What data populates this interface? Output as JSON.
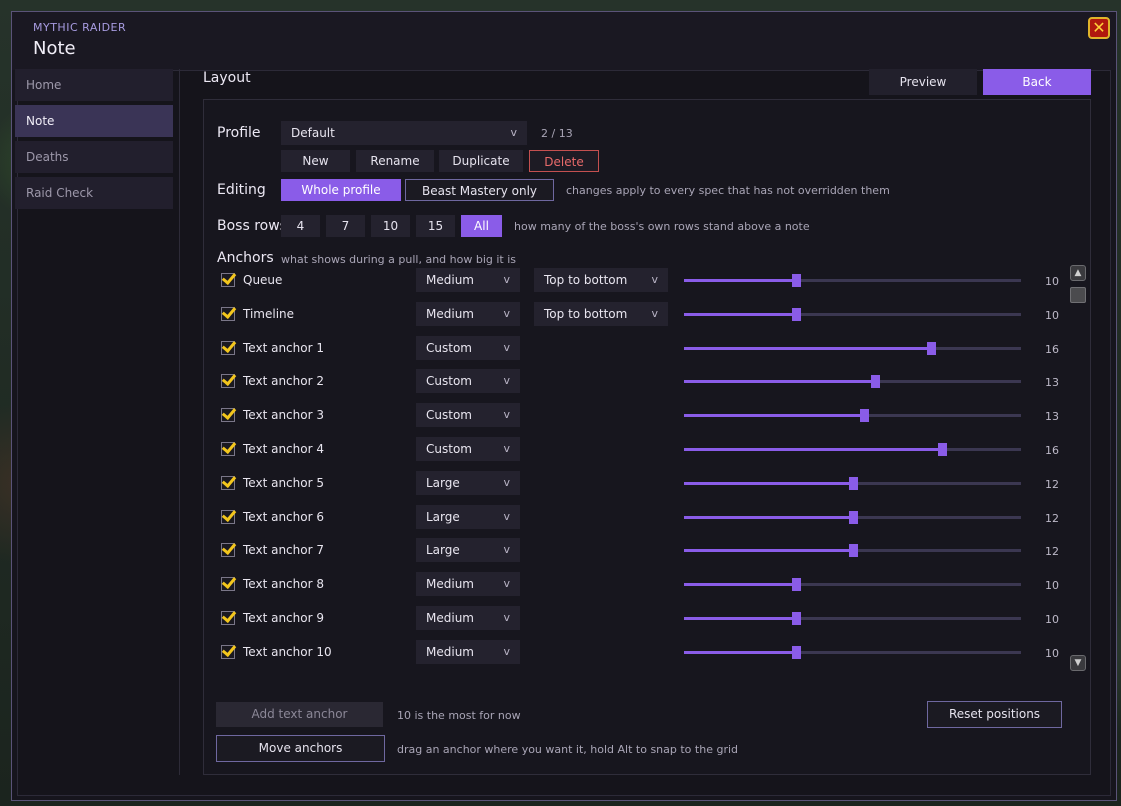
{
  "app_name": "MYTHIC RAIDER",
  "window_title": "Note",
  "sidebar": {
    "items": [
      {
        "label": "Home",
        "active": false
      },
      {
        "label": "Note",
        "active": true
      },
      {
        "label": "Deaths",
        "active": false
      },
      {
        "label": "Raid Check",
        "active": false
      }
    ]
  },
  "section_title": "Layout",
  "header_buttons": {
    "preview": "Preview",
    "back": "Back"
  },
  "profile": {
    "label": "Profile",
    "selected": "Default",
    "count": "2 / 13",
    "buttons": {
      "new": "New",
      "rename": "Rename",
      "duplicate": "Duplicate",
      "delete": "Delete"
    }
  },
  "editing": {
    "label": "Editing",
    "options": [
      "Whole profile",
      "Beast Mastery only"
    ],
    "selected": "Whole profile",
    "hint": "changes apply to every spec that has not overridden them"
  },
  "boss_rows": {
    "label": "Boss rows",
    "options": [
      "4",
      "7",
      "10",
      "15",
      "All"
    ],
    "selected": "All",
    "hint": "how many of the boss's own rows stand above a note"
  },
  "anchors": {
    "label": "Anchors",
    "hint": "what shows during a pull, and how big it is",
    "rows": [
      {
        "name": "Queue",
        "checked": true,
        "size": "Medium",
        "direction": "Top to bottom",
        "value": 100,
        "value_text": "10("
      },
      {
        "name": "Timeline",
        "checked": true,
        "size": "Medium",
        "direction": "Top to bottom",
        "value": 100,
        "value_text": "10("
      },
      {
        "name": "Text anchor 1",
        "checked": true,
        "size": "Custom",
        "direction": "",
        "value": 160,
        "value_text": "16("
      },
      {
        "name": "Text anchor 2",
        "checked": true,
        "size": "Custom",
        "direction": "",
        "value": 135,
        "value_text": "13!"
      },
      {
        "name": "Text anchor 3",
        "checked": true,
        "size": "Custom",
        "direction": "",
        "value": 130,
        "value_text": "13("
      },
      {
        "name": "Text anchor 4",
        "checked": true,
        "size": "Custom",
        "direction": "",
        "value": 165,
        "value_text": "16!"
      },
      {
        "name": "Text anchor 5",
        "checked": true,
        "size": "Large",
        "direction": "",
        "value": 125,
        "value_text": "12!"
      },
      {
        "name": "Text anchor 6",
        "checked": true,
        "size": "Large",
        "direction": "",
        "value": 125,
        "value_text": "12!"
      },
      {
        "name": "Text anchor 7",
        "checked": true,
        "size": "Large",
        "direction": "",
        "value": 125,
        "value_text": "12!"
      },
      {
        "name": "Text anchor 8",
        "checked": true,
        "size": "Medium",
        "direction": "",
        "value": 100,
        "value_text": "10("
      },
      {
        "name": "Text anchor 9",
        "checked": true,
        "size": "Medium",
        "direction": "",
        "value": 100,
        "value_text": "10("
      },
      {
        "name": "Text anchor 10",
        "checked": true,
        "size": "Medium",
        "direction": "",
        "value": 100,
        "value_text": "10("
      }
    ],
    "slider_min": 50,
    "slider_max": 200
  },
  "footer": {
    "add_anchor": "Add text anchor",
    "add_hint": "10 is the most for now",
    "reset": "Reset positions",
    "move": "Move anchors",
    "move_hint": "drag an anchor where you want it, hold Alt to snap to the grid"
  },
  "colors": {
    "accent": "#8a5ce8",
    "danger": "#e86a6a",
    "check": "#f3c61d"
  },
  "icons": {
    "close": "close-icon",
    "check": "checkmark-icon",
    "chevron": "chevron-down-icon"
  }
}
